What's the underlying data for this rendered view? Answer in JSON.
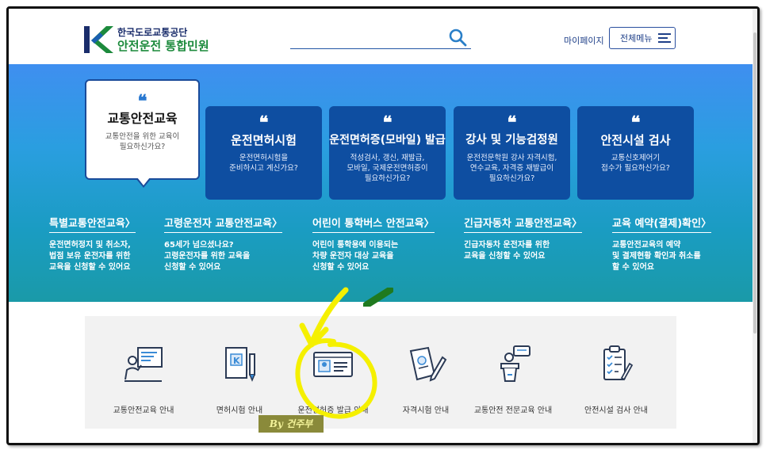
{
  "header": {
    "org_name": "한국도로교통공단",
    "service_name": "안전운전 통합민원",
    "mypage_label": "마이페이지",
    "menu_label": "전체메뉴",
    "search_icon": "search-icon",
    "menu_icon": "hamburger-icon"
  },
  "cards": [
    {
      "title": "교통안전교육",
      "desc1": "교통안전을 위한 교육이",
      "desc2": "필요하신가요?",
      "desc3": ""
    },
    {
      "title": "운전면허시험",
      "desc1": "운전면허시험을",
      "desc2": "준비하시고 계신가요?",
      "desc3": ""
    },
    {
      "title": "운전면허증(모바일) 발급",
      "desc1": "적성검사, 갱신, 재발급,",
      "desc2": "모바일, 국제운전면허증이",
      "desc3": "필요하신가요?"
    },
    {
      "title": "강사 및 기능검정원",
      "desc1": "운전전문학원 강사 자격시험,",
      "desc2": "연수교육, 자격증 재발급이",
      "desc3": "필요하신가요?"
    },
    {
      "title": "안전시설 검사",
      "desc1": "교통신호제어기",
      "desc2": "접수가 필요하신가요?",
      "desc3": ""
    }
  ],
  "quote_mark": "❝",
  "links": [
    {
      "title": "특별교통안전교육",
      "arrow": "〉",
      "desc1": "운전면허정지 및 취소자,",
      "desc2": "법점 보유 운전자를 위한",
      "desc3": "교육을 신청할 수 있어요"
    },
    {
      "title": "고령운전자 교통안전교육",
      "arrow": "〉",
      "desc1": "65세가 넘으셨나요?",
      "desc2": "고령운전자를 위한 교육을",
      "desc3": "신청할 수 있어요"
    },
    {
      "title": "어린이 통학버스 안전교육",
      "arrow": "〉",
      "desc1": "어린이 통학용에 이용되는",
      "desc2": "차량 운전자 대상 교육을",
      "desc3": "신청할 수 있어요"
    },
    {
      "title": "긴급자동차 교통안전교육",
      "arrow": "〉",
      "desc1": "긴급자동차 운전자를 위한",
      "desc2": "교육을 신청할 수 있어요",
      "desc3": ""
    },
    {
      "title": "교육 예약(결제)확인",
      "arrow": "〉",
      "desc1": "교통안전교육의 예약",
      "desc2": "및 결제현황 확인과 취소를",
      "desc3": "할 수 있어요"
    }
  ],
  "services": [
    {
      "label": "교통안전교육 안내",
      "icon": "teacher-board-icon"
    },
    {
      "label": "면허시험 안내",
      "icon": "book-pen-icon"
    },
    {
      "label": "운전면허증 발급 안내",
      "icon": "id-card-icon"
    },
    {
      "label": "자격시험 안내",
      "icon": "document-pen-icon"
    },
    {
      "label": "교통안전 전문교육 안내",
      "icon": "lecturer-podium-icon"
    },
    {
      "label": "안전시설 검사 안내",
      "icon": "clipboard-check-icon"
    }
  ],
  "watermark": "By 건주부",
  "colors": {
    "navy": "#0e4ea1",
    "brand_green": "#1c8a3c",
    "brand_navy": "#1a2d6b",
    "highlight": "#f5f000"
  }
}
